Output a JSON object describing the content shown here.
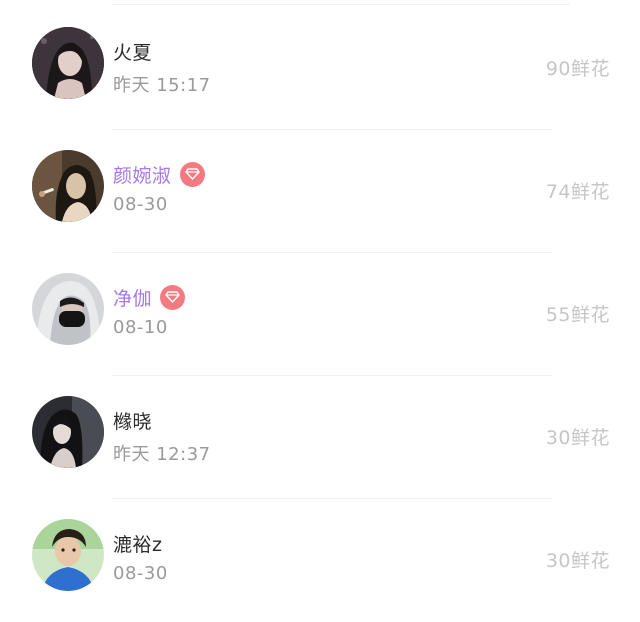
{
  "records": [
    {
      "name": "火夏",
      "vip": false,
      "time": "昨天 15:17",
      "flowers": "90鲜花",
      "avatar_color": "#3a3438"
    },
    {
      "name": "颜婉淑",
      "vip": true,
      "time": "08-30",
      "flowers": "74鲜花",
      "avatar_color": "#5c4a38"
    },
    {
      "name": "净伽",
      "vip": true,
      "time": "08-10",
      "flowers": "55鲜花",
      "avatar_color": "#c9ccd2"
    },
    {
      "name": "橼晓",
      "vip": false,
      "time": "昨天 12:37",
      "flowers": "30鲜花",
      "avatar_color": "#3b3d44"
    },
    {
      "name": "漉裕z",
      "vip": false,
      "time": "08-30",
      "flowers": "30鲜花",
      "avatar_color": "#2f6fcf"
    }
  ],
  "colors": {
    "vip_name": "#a678e8",
    "vip_badge": "#f47a82",
    "name": "#2b2b2b",
    "time": "#9a9a9a",
    "flowers": "#c6c6c6"
  },
  "icons": {
    "vip_badge": "diamond-icon",
    "avatar": "user-photo"
  }
}
